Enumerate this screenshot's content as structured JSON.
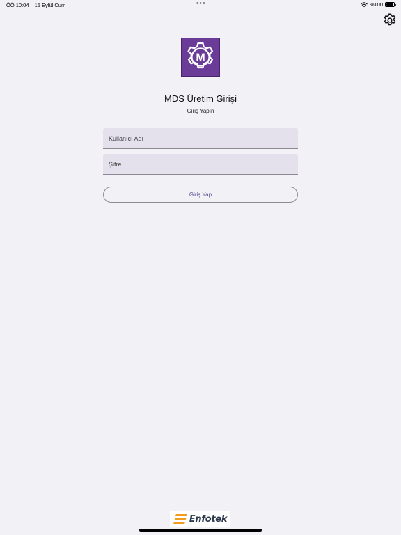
{
  "status_bar": {
    "time": "ÖÖ 10:04",
    "date": "15 Eylül Cum",
    "battery": "%100",
    "battery_level": 1.0
  },
  "settings": {
    "icon": "gear-icon"
  },
  "logo": {
    "letter": "M",
    "icon": "gear-logo-icon",
    "color": "#6b3b98"
  },
  "login": {
    "title": "MDS Üretim Girişi",
    "subtitle": "Giriş Yapın",
    "username_placeholder": "Kullanıcı Adı",
    "username_value": "",
    "password_placeholder": "Şifre",
    "password_value": "",
    "submit_label": "Giriş Yap"
  },
  "footer": {
    "brand": "Enfotek",
    "brand_color": "#f29b1d"
  },
  "colors": {
    "background": "#f2f1f6",
    "field_background": "#e4e1ec",
    "button_text": "#5a4d92"
  }
}
